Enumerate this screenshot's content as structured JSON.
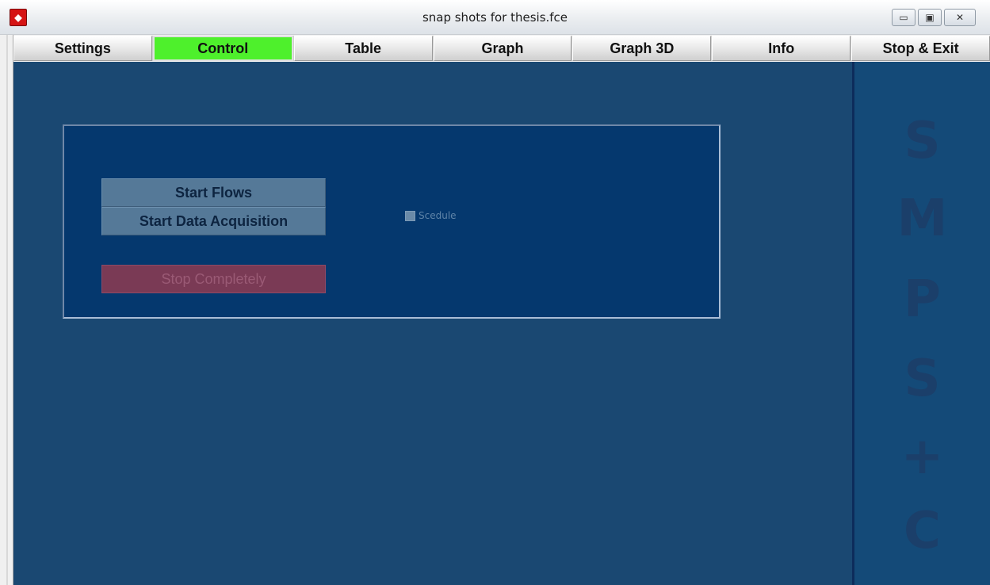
{
  "window": {
    "title": "snap shots for thesis.fce",
    "app_icon": "app-logo-icon",
    "controls": {
      "minimize": "▭",
      "maximize": "▣",
      "close": "✕"
    }
  },
  "tabs": [
    {
      "label": "Settings",
      "active": false
    },
    {
      "label": "Control",
      "active": true
    },
    {
      "label": "Table",
      "active": false
    },
    {
      "label": "Graph",
      "active": false
    },
    {
      "label": "Graph 3D",
      "active": false
    },
    {
      "label": "Info",
      "active": false
    },
    {
      "label": "Stop & Exit",
      "active": false
    }
  ],
  "control": {
    "start_flows": "Start Flows",
    "start_data_acquisition": "Start Data Acquisition",
    "stop_completely": "Stop Completely",
    "schedule_label": "Scedule",
    "schedule_checked": false
  },
  "sidebar": {
    "letters": [
      "S",
      "M",
      "P",
      "S",
      "+",
      "C"
    ]
  },
  "colors": {
    "active_tab": "#4ef02c",
    "background": "#1a4872",
    "panel": "#05386e",
    "stop_button": "#7a3a55"
  }
}
